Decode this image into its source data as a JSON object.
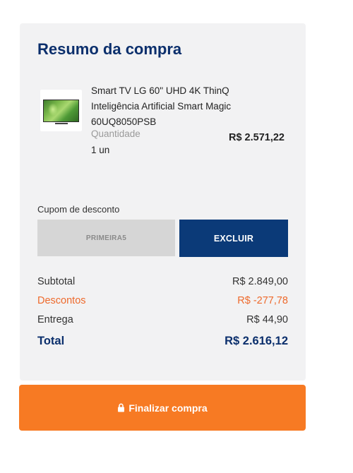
{
  "summary": {
    "title": "Resumo da compra"
  },
  "product": {
    "name": "Smart TV LG 60\" UHD 4K ThinQ Inteligência Artificial Smart Magic 60UQ8050PSB",
    "quantity_label": "Quantidade",
    "quantity_value": "1 un",
    "price": "R$ 2.571,22",
    "thumbnail_icon": "tv-thumbnail"
  },
  "coupon": {
    "label": "Cupom de desconto",
    "value": "PRIMEIRA5",
    "button_label": "EXCLUIR"
  },
  "totals": {
    "subtotal_label": "Subtotal",
    "subtotal_value": "R$ 2.849,00",
    "discount_label": "Descontos",
    "discount_value": "R$ -277,78",
    "shipping_label": "Entrega",
    "shipping_value": "R$ 44,90",
    "total_label": "Total",
    "total_value": "R$ 2.616,12"
  },
  "checkout": {
    "button_label": "Finalizar compra",
    "icon": "lock-icon"
  },
  "colors": {
    "primary_navy": "#0b2f6c",
    "button_navy": "#0b3a78",
    "accent_orange": "#f77a23",
    "discount_orange": "#ee6a2c",
    "card_background": "#f2f2f3"
  }
}
